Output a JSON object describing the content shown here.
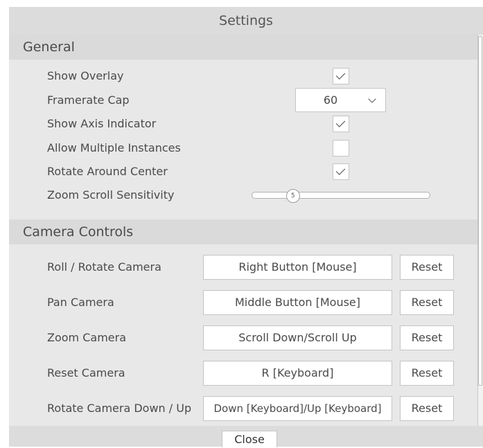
{
  "window": {
    "title": "Settings"
  },
  "general": {
    "header": "General",
    "show_overlay": {
      "label": "Show Overlay",
      "checked": true
    },
    "framerate_cap": {
      "label": "Framerate Cap",
      "value": "60"
    },
    "show_axis_indicator": {
      "label": "Show Axis Indicator",
      "checked": true
    },
    "allow_multiple_instances": {
      "label": "Allow Multiple Instances",
      "checked": false
    },
    "rotate_around_center": {
      "label": "Rotate Around Center",
      "checked": true
    },
    "zoom_scroll_sensitivity": {
      "label": "Zoom Scroll Sensitivity",
      "value": "5"
    }
  },
  "camera_controls": {
    "header": "Camera Controls",
    "reset_label": "Reset",
    "rows": [
      {
        "label": "Roll / Rotate Camera",
        "binding": "Right Button [Mouse]"
      },
      {
        "label": "Pan Camera",
        "binding": "Middle Button [Mouse]"
      },
      {
        "label": "Zoom Camera",
        "binding": "Scroll Down/Scroll Up"
      },
      {
        "label": "Reset Camera",
        "binding": "R [Keyboard]"
      },
      {
        "label": "Rotate Camera Down / Up",
        "binding": "Down [Keyboard]/Up [Keyboard]"
      }
    ]
  },
  "footer": {
    "close_label": "Close"
  },
  "icons": {
    "check": "check-icon",
    "dropdown": "chevron-down-icon"
  }
}
